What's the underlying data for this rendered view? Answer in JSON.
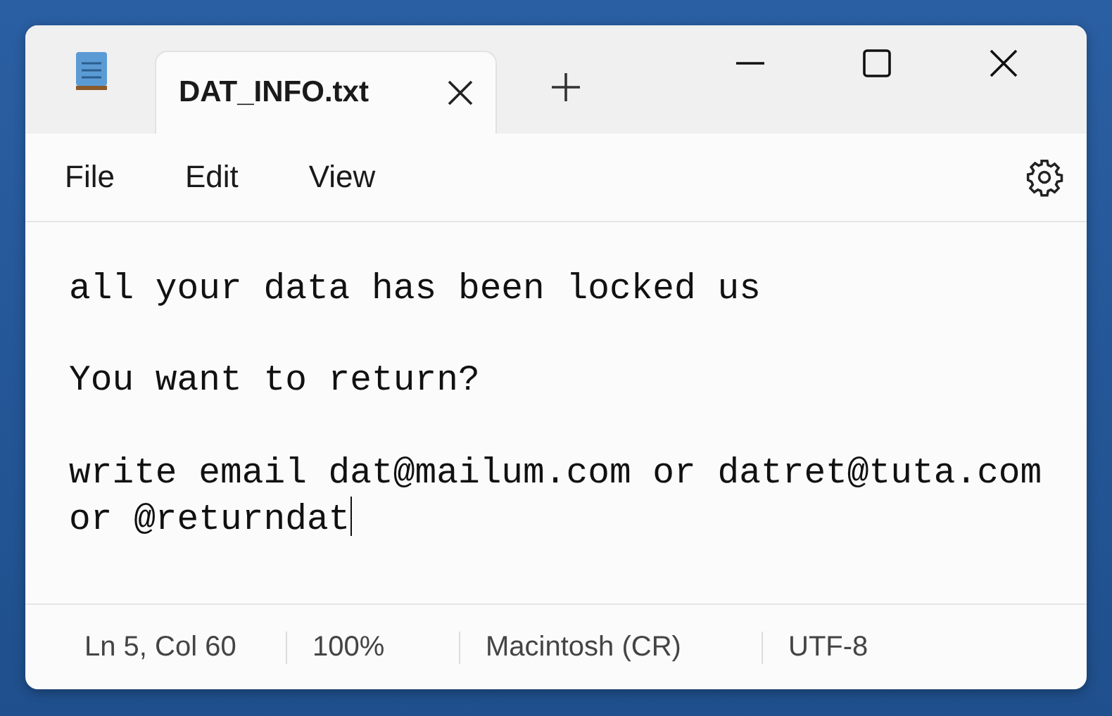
{
  "tab": {
    "title": "DAT_INFO.txt",
    "selected": true
  },
  "menu": [
    "File",
    "Edit",
    "View"
  ],
  "editor": {
    "paragraphs": [
      [
        "all your data has been locked us"
      ],
      [
        "You want to return?"
      ],
      [
        "write email dat@mailum.com or datret@tuta.com",
        "or @returndat"
      ]
    ]
  },
  "status_bar": [
    "Ln 5, Col 60",
    "100%",
    "Macintosh (CR)",
    "UTF-8"
  ]
}
